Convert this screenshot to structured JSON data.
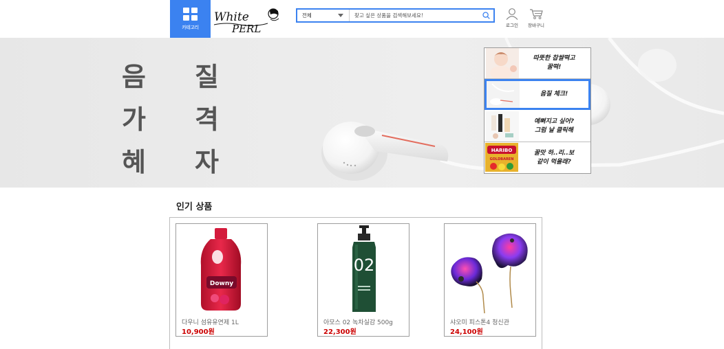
{
  "header": {
    "category_label": "카테고리",
    "logo_line1": "White",
    "logo_line2": "PERL",
    "search_select": "전체",
    "search_placeholder": "찾고 싶은 상품을 검색해보세요!",
    "login_label": "로그인",
    "cart_label": "장바구니",
    "accent_color": "#3b82f0"
  },
  "banner": {
    "text_col1": [
      "음",
      "가",
      "혜"
    ],
    "text_col2": [
      "질",
      "격",
      "자"
    ],
    "thumbnails": [
      {
        "caption": "따뜻한 찹쌀떡고\n꿀떡!",
        "icon": "doll-image",
        "active": false
      },
      {
        "caption": "음질 체크!",
        "icon": "earphone-image",
        "active": true
      },
      {
        "caption": "예뻐지고 싶어?\n그럼 날 클릭해",
        "icon": "cosmetics-image",
        "active": false
      },
      {
        "caption": "꿀맛 하..리..보\n같이 먹을래?",
        "icon": "haribo-image",
        "active": false
      }
    ],
    "haribo_label": "HARIBO",
    "haribo_sub": "GOLDBAREN"
  },
  "popular": {
    "title": "인기 상품",
    "products": [
      {
        "name": "다우니 섬유유연제 1L",
        "price": "10,900원",
        "icon": "downy-bottle-image",
        "label": "Downy"
      },
      {
        "name": "아모스 02 녹차실감 500g",
        "price": "22,300원",
        "icon": "amos-bottle-image",
        "label": "02"
      },
      {
        "name": "샤오미 피스톤4 청신관",
        "price": "24,100원",
        "icon": "earbuds-image",
        "label": ""
      }
    ]
  }
}
